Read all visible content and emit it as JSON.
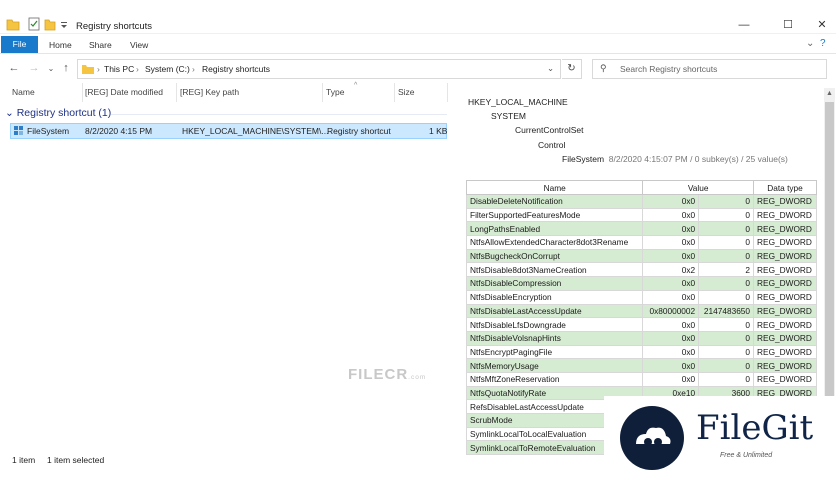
{
  "window": {
    "title": "Registry shortcuts"
  },
  "ribbon": {
    "tabs": [
      "File",
      "Home",
      "Share",
      "View"
    ]
  },
  "address": {
    "crumbs": [
      "This PC",
      "System (C:)",
      "Registry shortcuts"
    ]
  },
  "search": {
    "placeholder": "Search Registry shortcuts"
  },
  "columns": [
    "Name",
    "[REG] Date modified",
    "[REG] Key path",
    "Type",
    "Size"
  ],
  "group": {
    "label": "Registry shortcut (1)"
  },
  "file": {
    "name": "FileSystem",
    "date": "8/2/2020 4:15 PM",
    "path": "HKEY_LOCAL_MACHINE\\SYSTEM\\...",
    "type": "Registry shortcut",
    "size": "1 KB"
  },
  "status": {
    "count": "1 item",
    "selected": "1 item selected"
  },
  "preview": {
    "tree": [
      "HKEY_LOCAL_MACHINE",
      "SYSTEM",
      "CurrentControlSet",
      "Control",
      "FileSystem"
    ],
    "info": "8/2/2020 4:15:07 PM / 0 subkey(s) / 25 value(s)",
    "headers": [
      "Name",
      "Value",
      "Data type"
    ],
    "rows": [
      {
        "name": "DisableDeleteNotification",
        "hex": "0x0",
        "dec": "0",
        "type": "REG_DWORD"
      },
      {
        "name": "FilterSupportedFeaturesMode",
        "hex": "0x0",
        "dec": "0",
        "type": "REG_DWORD"
      },
      {
        "name": "LongPathsEnabled",
        "hex": "0x0",
        "dec": "0",
        "type": "REG_DWORD"
      },
      {
        "name": "NtfsAllowExtendedCharacter8dot3Rename",
        "hex": "0x0",
        "dec": "0",
        "type": "REG_DWORD"
      },
      {
        "name": "NtfsBugcheckOnCorrupt",
        "hex": "0x0",
        "dec": "0",
        "type": "REG_DWORD"
      },
      {
        "name": "NtfsDisable8dot3NameCreation",
        "hex": "0x2",
        "dec": "2",
        "type": "REG_DWORD"
      },
      {
        "name": "NtfsDisableCompression",
        "hex": "0x0",
        "dec": "0",
        "type": "REG_DWORD"
      },
      {
        "name": "NtfsDisableEncryption",
        "hex": "0x0",
        "dec": "0",
        "type": "REG_DWORD"
      },
      {
        "name": "NtfsDisableLastAccessUpdate",
        "hex": "0x80000002",
        "dec": "2147483650",
        "type": "REG_DWORD"
      },
      {
        "name": "NtfsDisableLfsDowngrade",
        "hex": "0x0",
        "dec": "0",
        "type": "REG_DWORD"
      },
      {
        "name": "NtfsDisableVolsnapHints",
        "hex": "0x0",
        "dec": "0",
        "type": "REG_DWORD"
      },
      {
        "name": "NtfsEncryptPagingFile",
        "hex": "0x0",
        "dec": "0",
        "type": "REG_DWORD"
      },
      {
        "name": "NtfsMemoryUsage",
        "hex": "0x0",
        "dec": "0",
        "type": "REG_DWORD"
      },
      {
        "name": "NtfsMftZoneReservation",
        "hex": "0x0",
        "dec": "0",
        "type": "REG_DWORD"
      },
      {
        "name": "NtfsQuotaNotifyRate",
        "hex": "0xe10",
        "dec": "3600",
        "type": "REG_DWORD"
      },
      {
        "name": "RefsDisableLastAccessUpdate",
        "hex": "",
        "dec": "",
        "type": ""
      },
      {
        "name": "ScrubMode",
        "hex": "",
        "dec": "",
        "type": ""
      },
      {
        "name": "SymlinkLocalToLocalEvaluation",
        "hex": "",
        "dec": "",
        "type": ""
      },
      {
        "name": "SymlinkLocalToRemoteEvaluation",
        "hex": "",
        "dec": "",
        "type": ""
      }
    ]
  },
  "watermarks": {
    "filecr": "FILECR",
    "filecr_suffix": ".com",
    "filegit": "FileGit",
    "filegit_sub": "Free & Unlimited"
  },
  "colors": {
    "accent": "#1979ca",
    "selection": "#cce8ff",
    "highlight_row": "#d6ecd2"
  }
}
